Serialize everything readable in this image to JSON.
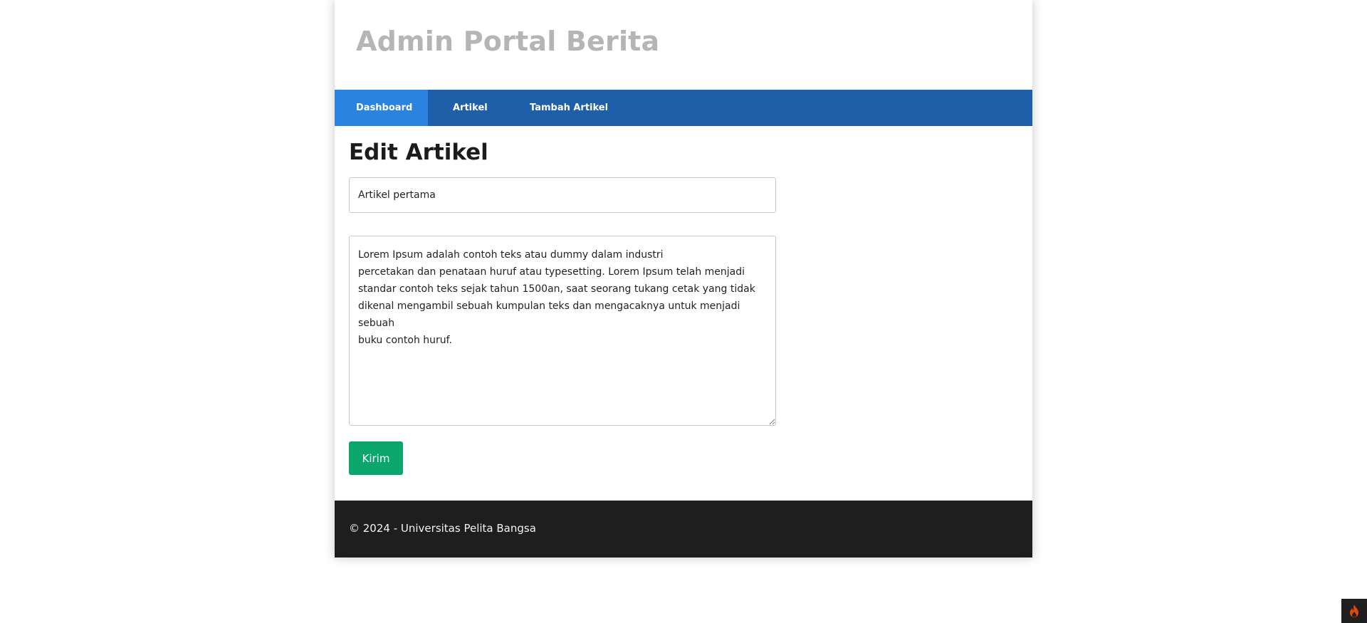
{
  "header": {
    "site_title": "Admin Portal Berita"
  },
  "nav": {
    "items": [
      {
        "label": "Dashboard",
        "active": true
      },
      {
        "label": "Artikel",
        "active": false
      },
      {
        "label": "Tambah Artikel",
        "active": false
      }
    ]
  },
  "main": {
    "page_title": "Edit Artikel",
    "title_field_value": "Artikel pertama",
    "content_field_value": "Lorem Ipsum adalah contoh teks atau dummy dalam industri\npercetakan dan penataan huruf atau typesetting. Lorem Ipsum telah menjadi standar contoh teks sejak tahun 1500an, saat seorang tukang cetak yang tidak dikenal mengambil sebuah kumpulan teks dan mengacaknya untuk menjadi sebuah\nbuku contoh huruf.",
    "submit_label": "Kirim"
  },
  "footer": {
    "text": "© 2024 - Universitas Pelita Bangsa"
  },
  "debug_toolbar": {
    "icon": "flame-icon"
  },
  "colors": {
    "nav_bg": "#1f5faa",
    "nav_active": "#2b83e0",
    "submit": "#0aa66b",
    "footer_bg": "#1e1e1e",
    "title_gray": "#b5b5b5",
    "flame": "#dd4814"
  }
}
